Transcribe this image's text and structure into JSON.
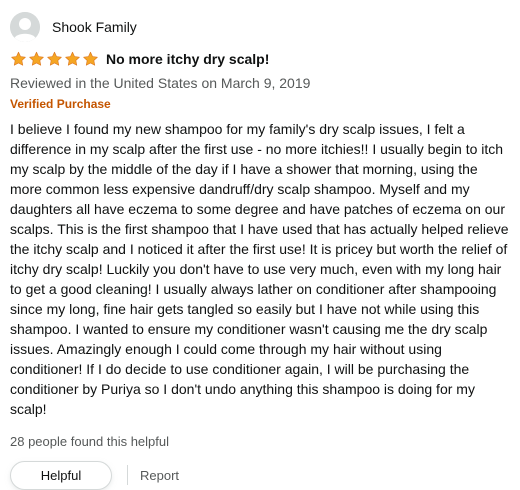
{
  "reviewer": {
    "name": "Shook Family",
    "avatar_icon": "default-user-avatar-icon"
  },
  "rating": {
    "stars": 5,
    "max_stars": 5,
    "star_color": "#f5a623"
  },
  "review": {
    "title": "No more itchy dry scalp!",
    "date_line": "Reviewed in the United States on March 9, 2019",
    "verified_label": "Verified Purchase",
    "body": "I believe I found my new shampoo for my family's dry scalp issues, I felt a difference in my scalp after the first use - no more itchies!! I usually begin to itch my scalp by the middle of the day if I have a shower that morning, using the more common less expensive dandruff/dry scalp shampoo. Myself and my daughters all have eczema to some degree and have patches of eczema on our scalps. This is the first shampoo that I have used that has actually helped relieve the itchy scalp and I noticed it after the first use! It is pricey but worth the relief of itchy dry scalp! Luckily you don't have to use very much, even with my long hair to get a good cleaning! I usually always lather on conditioner after shampooing since my long, fine hair gets tangled so easily but I have not while using this shampoo. I wanted to ensure my conditioner wasn't causing me the dry scalp issues. Amazingly enough I could come through my hair without using conditioner! If I do decide to use conditioner again, I will be purchasing the conditioner by Puriya so I don't undo anything this shampoo is doing for my scalp!",
    "helpful_count_text": "28 people found this helpful"
  },
  "actions": {
    "helpful_label": "Helpful",
    "report_label": "Report"
  },
  "colors": {
    "verified": "#c45500",
    "secondary_text": "#565959",
    "primary_text": "#0f1111"
  }
}
